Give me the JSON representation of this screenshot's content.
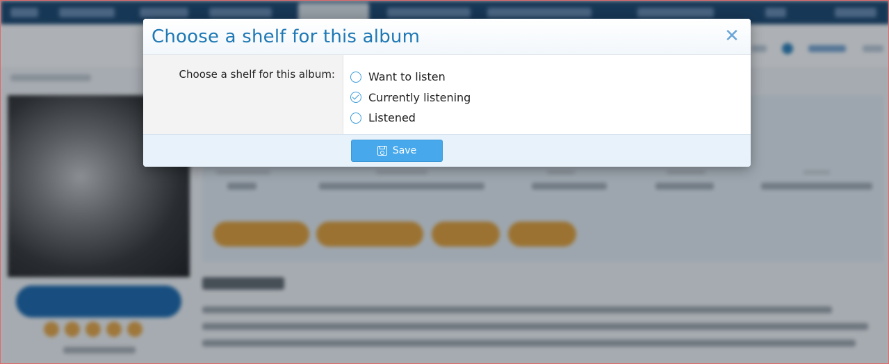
{
  "modal": {
    "title": "Choose a shelf for this album",
    "close_icon": "close-icon",
    "close_glyph": "✕",
    "field_label": "Choose a shelf for this album:",
    "options": [
      {
        "label": "Want to listen",
        "checked": false
      },
      {
        "label": "Currently listening",
        "checked": true
      },
      {
        "label": "Listened",
        "checked": false
      }
    ],
    "save_label": "Save",
    "save_icon": "floppy-disk-icon"
  },
  "colors": {
    "title": "#1f78b4",
    "save_button": "#47a9ec",
    "radio": "#3a9ad9",
    "footer_bg": "#e8f2fa",
    "action_buttons": "#e39a2b",
    "nav_bg": "#0d3b66"
  }
}
